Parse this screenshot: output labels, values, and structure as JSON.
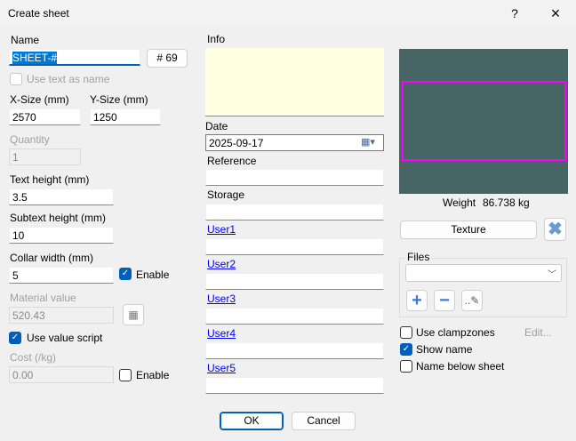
{
  "window": {
    "title": "Create sheet",
    "help": "?",
    "close": "×"
  },
  "left": {
    "name_label": "Name",
    "name_value": "SHEET-#",
    "number_button": "# 69",
    "use_text_as_name": "Use text as name",
    "xsize_label": "X-Size (mm)",
    "xsize_value": "2570",
    "ysize_label": "Y-Size (mm)",
    "ysize_value": "1250",
    "quantity_label": "Quantity",
    "quantity_value": "1",
    "text_height_label": "Text height (mm)",
    "text_height_value": "3.5",
    "subtext_height_label": "Subtext height (mm)",
    "subtext_height_value": "10",
    "collar_width_label": "Collar width (mm)",
    "collar_width_value": "5",
    "collar_enable": "Enable",
    "material_value_label": "Material value",
    "material_value": "520.43",
    "use_value_script": "Use value script",
    "cost_label": "Cost (/kg)",
    "cost_value": "0.00",
    "cost_enable": "Enable"
  },
  "middle": {
    "info_label": "Info",
    "info_value": "",
    "date_label": "Date",
    "date_value": "2025-09-17",
    "reference_label": "Reference",
    "storage_label": "Storage",
    "users": [
      "User1",
      "User2",
      "User3",
      "User4",
      "User5"
    ]
  },
  "right": {
    "weight_label": "Weight",
    "weight_value": "86.738 kg",
    "texture_button": "Texture",
    "files_label": "Files",
    "use_clampzones": "Use clampzones",
    "edit_link": "Edit...",
    "show_name": "Show name",
    "name_below_sheet": "Name below sheet",
    "preview_bg": "#476564",
    "outline_color": "#ff00ff"
  },
  "footer": {
    "ok": "OK",
    "cancel": "Cancel"
  }
}
